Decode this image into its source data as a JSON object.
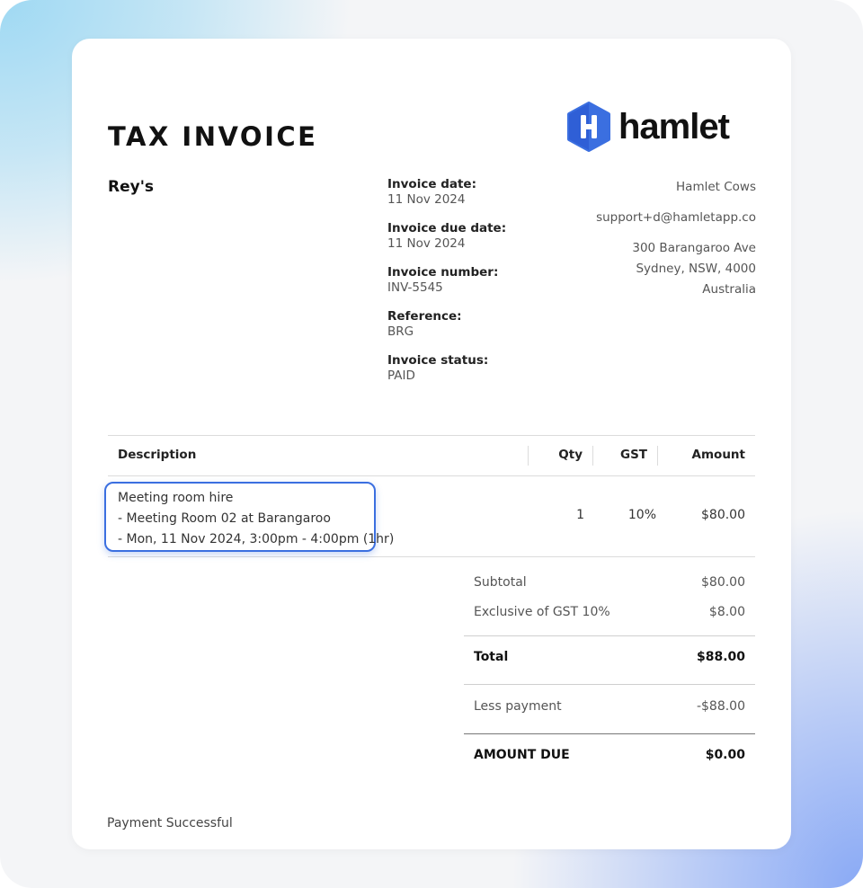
{
  "document": {
    "title": "TAX INVOICE",
    "customer": "Rey's"
  },
  "brand": {
    "logo_word": "hamlet",
    "accent_color": "#3b6fe0",
    "logo_icon": "hamlet-h-hexagon-icon"
  },
  "meta": [
    {
      "label": "Invoice date:",
      "value": "11 Nov 2024"
    },
    {
      "label": "Invoice due date:",
      "value": "11 Nov 2024"
    },
    {
      "label": "Invoice number:",
      "value": "INV-5545"
    },
    {
      "label": "Reference:",
      "value": "BRG"
    },
    {
      "label": "Invoice status:",
      "value": "PAID"
    }
  ],
  "company": {
    "name": "Hamlet Cows",
    "email": "support+d@hamletapp.co",
    "address_line1": "300 Barangaroo Ave",
    "address_line2": "Sydney, NSW, 4000",
    "country": "Australia"
  },
  "table": {
    "headers": {
      "description": "Description",
      "qty": "Qty",
      "gst": "GST",
      "amount": "Amount"
    },
    "rows": [
      {
        "description": [
          "Meeting room hire",
          "- Meeting Room 02 at Barangaroo",
          "- Mon, 11 Nov 2024, 3:00pm - 4:00pm (1hr)"
        ],
        "qty": "1",
        "gst": "10%",
        "amount": "$80.00"
      }
    ]
  },
  "summary": {
    "subtotal_label": "Subtotal",
    "subtotal_value": "$80.00",
    "gst_label": "Exclusive of GST 10%",
    "gst_value": "$8.00",
    "total_label": "Total",
    "total_value": "$88.00",
    "payment_label": "Less payment",
    "payment_value": "-$88.00",
    "due_label": "AMOUNT DUE",
    "due_value": "$0.00"
  },
  "footer": {
    "text": "Payment Successful"
  }
}
